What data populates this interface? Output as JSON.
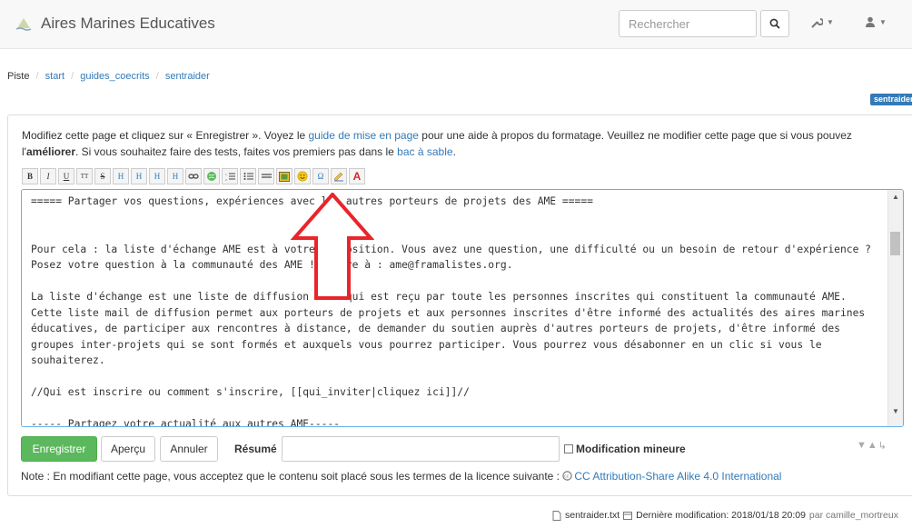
{
  "header": {
    "title": "Aires Marines Educatives",
    "search_placeholder": "Rechercher",
    "icons": [
      "logo-icon",
      "search-icon",
      "wrench-icon",
      "user-icon"
    ]
  },
  "breadcrumb": {
    "label": "Piste",
    "items": [
      "start",
      "guides_coecrits",
      "sentraider"
    ]
  },
  "page_badge": "sentraider",
  "intro": {
    "p1": "Modifiez cette page et cliquez sur « Enregistrer ». Voyez le ",
    "link1": "guide de mise en page",
    "p2": " pour une aide à propos du formatage. Veuillez ne modifier cette page que si vous pouvez l'",
    "strong": "améliorer",
    "p3": ". Si vous souhaitez faire des tests, faites vos premiers pas dans le ",
    "link2": "bac à sable",
    "p4": "."
  },
  "toolbar": {
    "buttons": [
      "B",
      "I",
      "U",
      "TT",
      "S",
      "H",
      "H",
      "H",
      "H",
      "link",
      "globe",
      "ol",
      "ul",
      "hr",
      "image",
      "smiley",
      "Ω",
      "signature",
      "A"
    ]
  },
  "editor": {
    "text": "===== Partager vos questions, expériences avec les autres porteurs de projets des AME =====\n\n\nPour cela : la liste d'échange AME est à votre disposition. Vous avez une question, une difficulté ou un besoin de retour d'expérience ? Posez votre question à la communauté des AME ! Ecrire à : ame@framalistes.org.\n\nLa liste d'échange est une liste de diffusion mail qui est reçu par toute les personnes inscrites qui constituent la communauté AME. Cette liste mail de diffusion permet aux porteurs de projets et aux personnes inscrites d'être informé des actualités des aires marines éducatives, de participer aux rencontres à distance, de demander du soutien auprès d'autres porteurs de projets, d'être informé des groupes inter-projets qui se sont formés et auxquels vous pourrez participer. Vous pourrez vous désabonner en un clic si vous le souhaiterez.\n\n//Qui est inscrire ou comment s'inscrire, [[qui_inviter|cliquez ici]]//\n\n----- Partagez votre actualité aux autres AME-----"
  },
  "actions": {
    "save": "Enregistrer",
    "preview": "Aperçu",
    "cancel": "Annuler",
    "summary_label": "Résumé",
    "summary_value": "",
    "minor_label": "Modification mineure",
    "minor_checked": false
  },
  "license": {
    "text": "Note : En modifiant cette page, vous acceptez que le contenu soit placé sous les termes de la licence suivante : ",
    "link": "CC Attribution-Share Alike 4.0 International"
  },
  "footer": {
    "file": "sentraider.txt",
    "modified": "Dernière modification: 2018/01/18 20:09",
    "by": "par camille_mortreux"
  },
  "colors": {
    "accent": "#337ab7",
    "save_button": "#5cb85c",
    "annotation_arrow": "#e8252b"
  }
}
